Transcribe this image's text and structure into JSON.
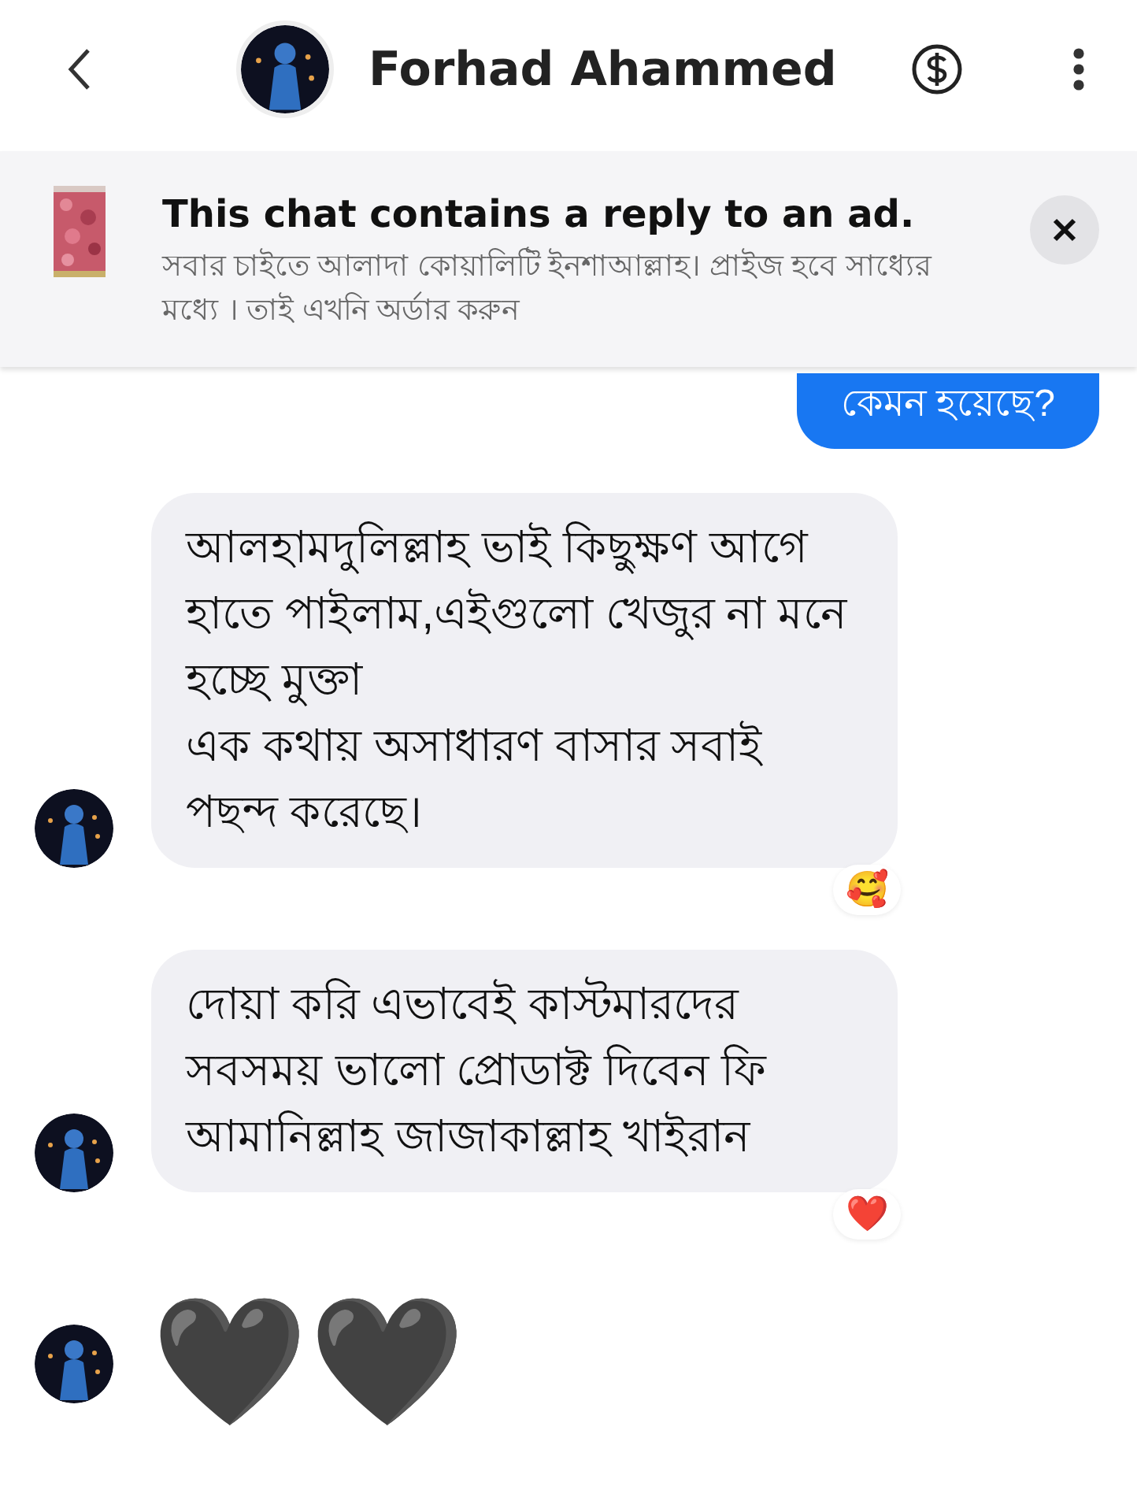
{
  "header": {
    "name": "Forhad Ahammed"
  },
  "ad_notice": {
    "title": "This chat contains a reply to an ad.",
    "text": "সবার চাইতে আলাদা কোয়ালিটি ইনশাআল্লাহ। প্রাইজ হবে সাধ্যের মধ্যে । তাই এখনি অর্ডার করুন"
  },
  "messages": [
    {
      "kind": "sent",
      "text": "কেমন হয়েছে?"
    },
    {
      "kind": "received",
      "text": "আলহামদুলিল্লাহ ভাই কিছুক্ষণ আগে হাতে পাইলাম,এইগুলো খেজুর না মনে হচ্ছে মুক্তা\nএক কথায় অসাধারণ বাসার সবাই পছন্দ করেছে।",
      "reaction": "🥰"
    },
    {
      "kind": "received",
      "text": "দোয়া করি এভাবেই কাস্টমারদের সবসময় ভালো প্রোডাক্ট দিবেন ফি আমানিল্লাহ জাজাকাল্লাহ খাইরান",
      "reaction": "❤️"
    },
    {
      "kind": "emoji",
      "text": "🖤🖤"
    }
  ]
}
